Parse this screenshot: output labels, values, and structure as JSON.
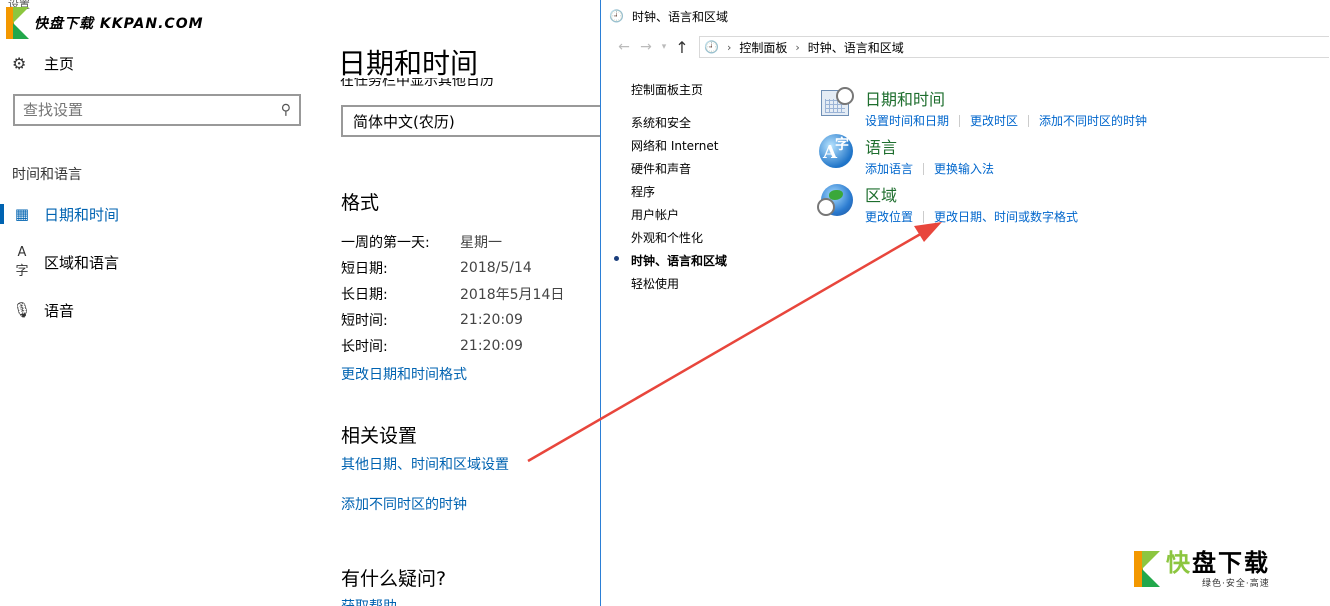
{
  "watermark": {
    "text": "快盘下载 KKPAN.COM",
    "settings_label": "设置"
  },
  "settings": {
    "nav": {
      "home": "主页",
      "search_placeholder": "查找设置",
      "section": "时间和语言",
      "items": [
        {
          "label": "日期和时间",
          "icon": "calendar-clock-icon",
          "active": true
        },
        {
          "label": "区域和语言",
          "icon": "language-icon",
          "active": false
        },
        {
          "label": "语音",
          "icon": "microphone-icon",
          "active": false
        }
      ]
    },
    "page_title": "日期和时间",
    "cut_text": "在任务栏中显示其他日历",
    "calendar_select": "简体中文(农历)",
    "format": {
      "heading": "格式",
      "rows": [
        {
          "k": "一周的第一天:",
          "v": "星期一"
        },
        {
          "k": "短日期:",
          "v": "2018/5/14"
        },
        {
          "k": "长日期:",
          "v": "2018年5月14日"
        },
        {
          "k": "短时间:",
          "v": "21:20:09"
        },
        {
          "k": "长时间:",
          "v": "21:20:09"
        }
      ],
      "change_link": "更改日期和时间格式"
    },
    "related": {
      "heading": "相关设置",
      "link1": "其他日期、时间和区域设置",
      "link2": "添加不同时区的时钟"
    },
    "question": {
      "heading": "有什么疑问?",
      "link": "获取帮助"
    }
  },
  "control_panel": {
    "title": "时钟、语言和区域",
    "address": {
      "part1": "控制面板",
      "part2": "时钟、语言和区域"
    },
    "sidebar": [
      "控制面板主页",
      "系统和安全",
      "网络和 Internet",
      "硬件和声音",
      "程序",
      "用户帐户",
      "外观和个性化",
      "时钟、语言和区域",
      "轻松使用"
    ],
    "categories": [
      {
        "title": "日期和时间",
        "links": [
          "设置时间和日期",
          "更改时区",
          "添加不同时区的时钟"
        ]
      },
      {
        "title": "语言",
        "links": [
          "添加语言",
          "更换输入法"
        ]
      },
      {
        "title": "区域",
        "links": [
          "更改位置",
          "更改日期、时间或数字格式"
        ]
      }
    ]
  },
  "logo": {
    "big_kuai": "快",
    "big_rest": "盘下载",
    "slogan": "绿色·安全·高速"
  },
  "colors": {
    "accent": "#0063b1",
    "arrow": "#e8463c",
    "category_title": "#1e6e2e"
  }
}
